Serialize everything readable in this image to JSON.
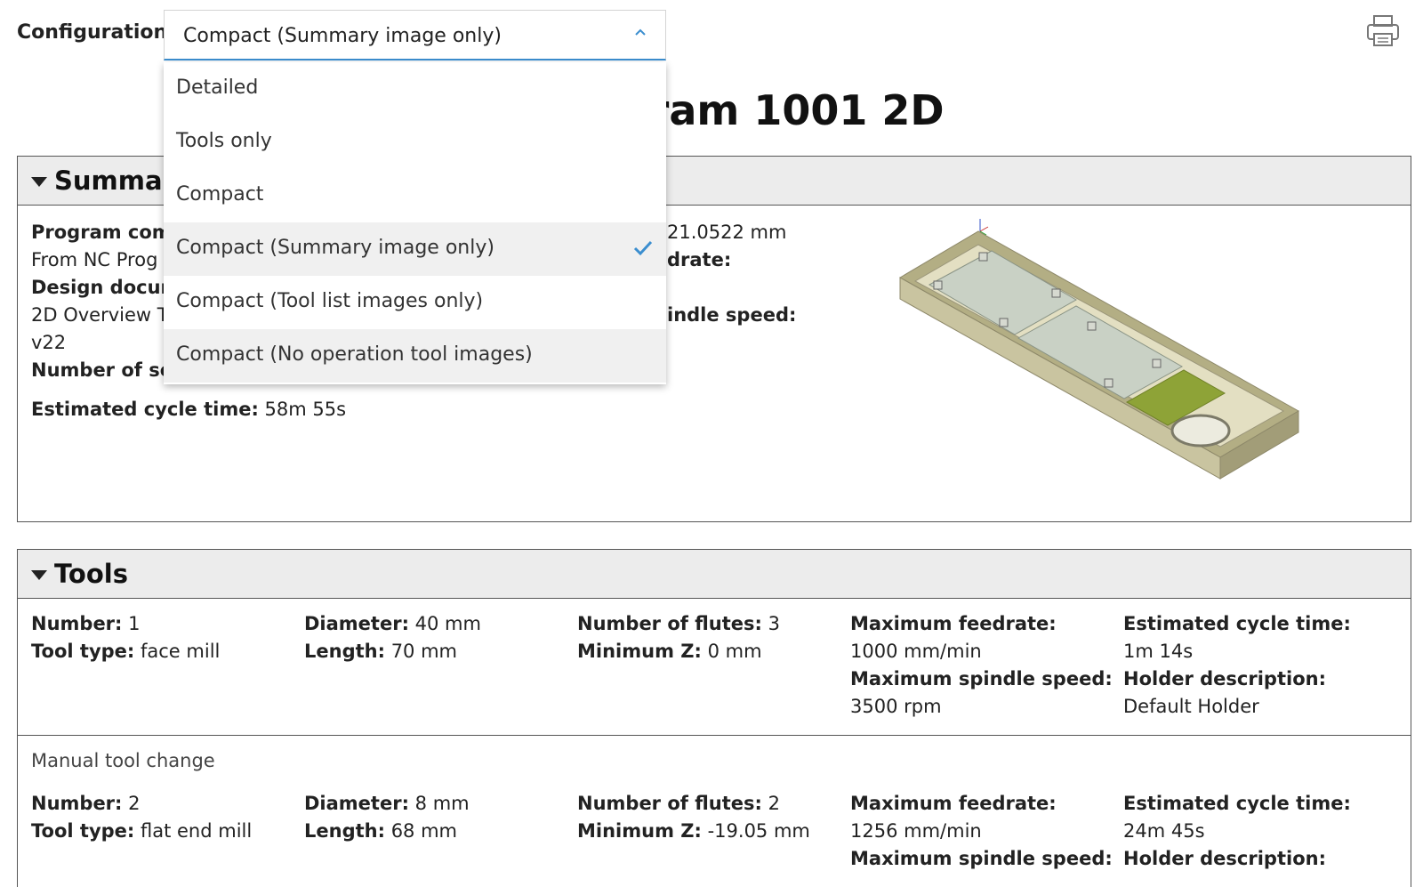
{
  "config": {
    "label": "Configuration:",
    "selected": "Compact (Summary image only)",
    "options": [
      {
        "label": "Detailed"
      },
      {
        "label": "Tools only"
      },
      {
        "label": "Compact"
      },
      {
        "label": "Compact (Summary image only)",
        "selected": true
      },
      {
        "label": "Compact (Tool list images only)"
      },
      {
        "label": "Compact (No operation tool images)"
      }
    ],
    "chevron_icon": "chevron-up-icon",
    "check_icon": "checkmark-icon",
    "accent_color": "#3b8ecf"
  },
  "print_icon": "printer-icon",
  "page_title": "or Program 1001 2D",
  "summary": {
    "heading": "Summary",
    "program_comment_label": "Program com",
    "program_comment_value": "From NC Prog",
    "design_document_label": "Design docum",
    "design_document_value": "2D Overview T",
    "design_version": "v22",
    "number_of_setups_label": "Number of se",
    "cycle_time_label": "Estimated cycle time:",
    "cycle_time_value": "58m 55s",
    "extent_value": "21.0522 mm",
    "feedrate_label": "drate:",
    "spindle_label": "indle speed:",
    "image_icon": "part-model-image"
  },
  "tools": {
    "heading": "Tools",
    "manual_tool_change": "Manual tool change",
    "labels": {
      "number": "Number:",
      "tool_type": "Tool type:",
      "diameter": "Diameter:",
      "length": "Length:",
      "flutes": "Number of flutes:",
      "min_z": "Minimum Z:",
      "max_feed": "Maximum feedrate:",
      "max_spindle": "Maximum spindle speed:",
      "cycle_time": "Estimated cycle time:",
      "holder": "Holder description:"
    },
    "items": [
      {
        "number": "1",
        "tool_type": "face mill",
        "diameter": "40 mm",
        "length": "70 mm",
        "flutes": "3",
        "min_z": "0 mm",
        "max_feed": "1000 mm/min",
        "max_spindle": "3500 rpm",
        "cycle_time": "1m 14s",
        "holder": "Default Holder"
      },
      {
        "number": "2",
        "tool_type": "flat end mill",
        "diameter": "8 mm",
        "length": "68 mm",
        "flutes": "2",
        "min_z": "-19.05 mm",
        "max_feed": "1256 mm/min",
        "cycle_time": "24m 45s"
      }
    ]
  }
}
